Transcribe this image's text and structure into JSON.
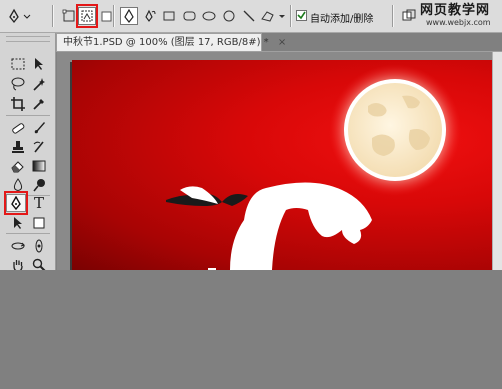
{
  "options_bar": {
    "auto_add_delete_label": "自动添加/删除",
    "auto_add_delete_checked": true,
    "shape_buttons": [
      "pen-icon",
      "freeform-pen-icon",
      "rectangle-icon",
      "rounded-rectangle-icon",
      "ellipse-icon",
      "polygon-icon",
      "line-icon",
      "custom-shape-icon"
    ]
  },
  "document": {
    "tab_title": "中秋节1.PSD @ 100% (图层 17, RGB/8#) *",
    "close_glyph": "×"
  },
  "watermark": {
    "line1": "网页教学网",
    "line2": "www.webjx.com"
  },
  "toolbox": {
    "highlighted_tool": "pen-tool",
    "text_tool_glyph": "T"
  },
  "colors": {
    "highlight": "#e41818",
    "artboard_red": "#d80808",
    "moon": "#faecd0",
    "ui_gray": "#d4d4d4"
  }
}
